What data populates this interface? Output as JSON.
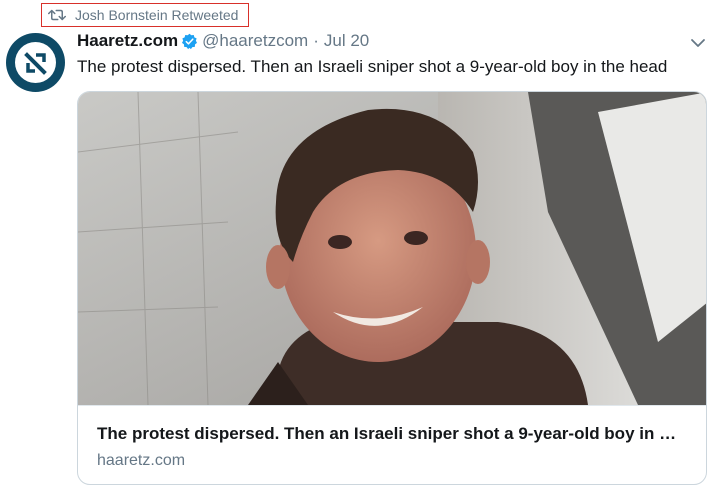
{
  "retweet": {
    "text": "Josh Bornstein Retweeted",
    "icon": "retweet-icon"
  },
  "tweet": {
    "display_name": "Haaretz.com",
    "handle": "@haaretzcom",
    "separator": "·",
    "date": "Jul 20",
    "text": "The protest dispersed. Then an Israeli sniper shot a 9-year-old boy in the head",
    "verified": true
  },
  "card": {
    "title": "The protest dispersed. Then an Israeli sniper shot a 9-year-old boy in …",
    "domain": "haaretz.com"
  },
  "colors": {
    "avatar_bg": "#0e4a66",
    "verified_blue": "#1da1f2",
    "highlight_red": "#d8302a",
    "muted_text": "#657786"
  }
}
